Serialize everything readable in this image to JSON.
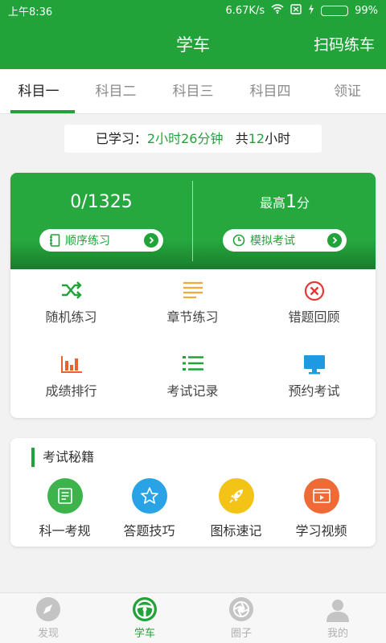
{
  "status_bar": {
    "time": "上午8:36",
    "network_speed": "6.67K/s",
    "battery_percent": "99%",
    "battery_level": 0.99
  },
  "app_bar": {
    "title": "学车",
    "action_label": "扫码练车"
  },
  "tabs": [
    {
      "label": "科目一",
      "active": true
    },
    {
      "label": "科目二",
      "active": false
    },
    {
      "label": "科目三",
      "active": false
    },
    {
      "label": "科目四",
      "active": false
    },
    {
      "label": "领证",
      "active": false
    }
  ],
  "study_summary": {
    "studied_prefix": "已学习：",
    "studied_value": "2小时26分钟",
    "total_prefix": "共",
    "total_value": "12",
    "total_unit": "小时"
  },
  "practice_card": {
    "progress_text": "0/1325",
    "sequential_button": "顺序练习",
    "best_prefix": "最高",
    "best_value": "1",
    "best_unit": "分",
    "mock_exam_button": "模拟考试"
  },
  "feature_grid": [
    {
      "label": "随机练习",
      "icon": "shuffle-icon",
      "color": "#22a33a"
    },
    {
      "label": "章节练习",
      "icon": "list-lines-icon",
      "color": "#f2a93b"
    },
    {
      "label": "错题回顾",
      "icon": "close-circle-icon",
      "color": "#e53935"
    },
    {
      "label": "成绩排行",
      "icon": "bar-chart-icon",
      "color": "#e8642c"
    },
    {
      "label": "考试记录",
      "icon": "bullet-list-icon",
      "color": "#22a33a"
    },
    {
      "label": "预约考试",
      "icon": "monitor-icon",
      "color": "#1e9be0"
    }
  ],
  "tips_card": {
    "title": "考试秘籍",
    "items": [
      {
        "label": "科一考规",
        "icon": "document-icon",
        "color": "#3cb44b"
      },
      {
        "label": "答题技巧",
        "icon": "star-icon",
        "color": "#2aa3e6"
      },
      {
        "label": "图标速记",
        "icon": "rocket-icon",
        "color": "#f3c316"
      },
      {
        "label": "学习视频",
        "icon": "video-icon",
        "color": "#f06a35"
      }
    ]
  },
  "bottom_nav": [
    {
      "label": "发现",
      "icon": "compass-icon",
      "active": false
    },
    {
      "label": "学车",
      "icon": "steering-wheel-icon",
      "active": true
    },
    {
      "label": "圈子",
      "icon": "camera-aperture-icon",
      "active": false
    },
    {
      "label": "我的",
      "icon": "user-icon",
      "active": false
    }
  ],
  "colors": {
    "brand_green": "#22a33a",
    "background": "#f2f2f2"
  }
}
